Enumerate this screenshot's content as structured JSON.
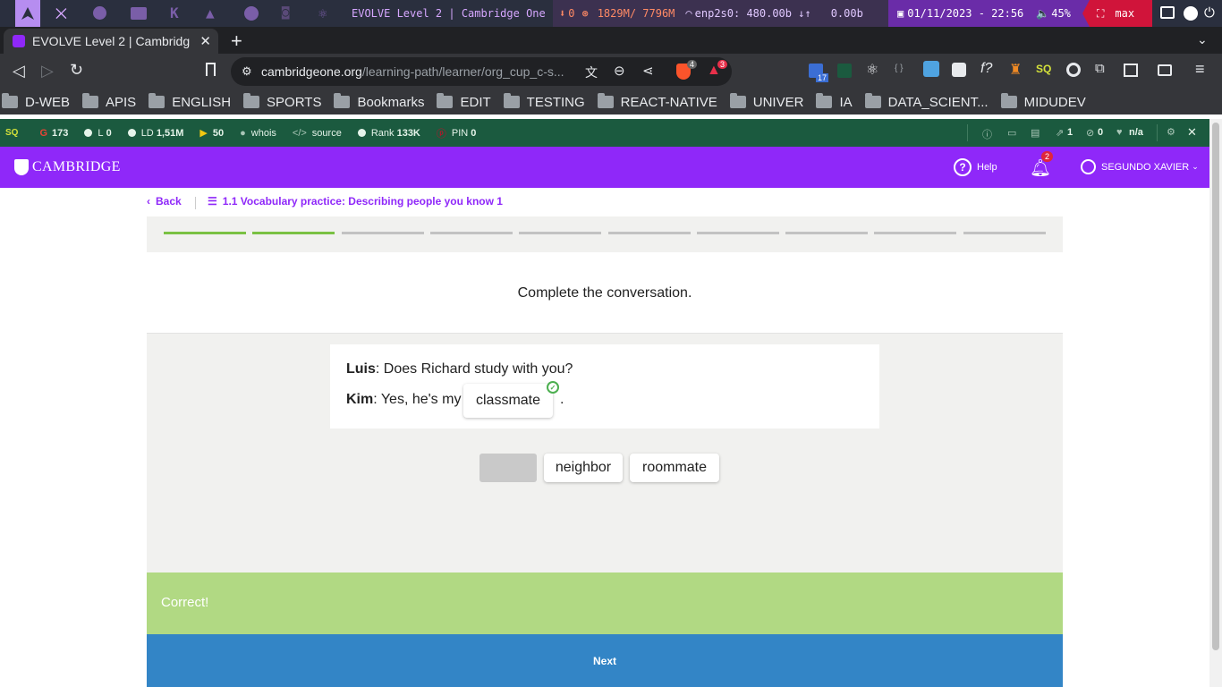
{
  "system_bar": {
    "window_title": "EVOLVE Level 2 | Cambridge One",
    "download": "0",
    "memory": "1829M/ 7796M",
    "network": "enp2s0: 480.00b ↓↑",
    "network_up": "0.00b",
    "datetime": "01/11/2023 - 22:56",
    "volume": "45%",
    "mode": "max"
  },
  "browser": {
    "tab_title": "EVOLVE Level 2 | Cambridg",
    "url_host": "cambridgeone.org",
    "url_path": "/learning-path/learner/org_cup_c-s...",
    "brave_badge": "4",
    "alert_badge": "3",
    "ext_badge": "17",
    "bookmarks": [
      "D-WEB",
      "APIS",
      "ENGLISH",
      "SPORTS",
      "Bookmarks",
      "EDIT",
      "TESTING",
      "REACT-NATIVE",
      "UNIVER",
      "IA",
      "DATA_SCIENT...",
      "MIDUDEV"
    ]
  },
  "seo_bar": {
    "g": "173",
    "l": "0",
    "ld_label": "LD",
    "ld": "1,51M",
    "b": "50",
    "whois": "whois",
    "source": "source",
    "rank_label": "Rank",
    "rank": "133K",
    "pin_label": "PIN",
    "pin": "0",
    "right_1": "1",
    "right_2": "0",
    "right_3": "n/a"
  },
  "site": {
    "logo": "CAMBRIDGE",
    "help": "Help",
    "notif_count": "2",
    "user": "SEGUNDO XAVIER"
  },
  "lesson": {
    "back": "Back",
    "title": "1.1 Vocabulary practice: Describing people you know 1",
    "progress_done": 2,
    "progress_total": 10,
    "instruction": "Complete the conversation.",
    "line1_speaker": "Luis",
    "line1_text": ": Does Richard study with you?",
    "line2_speaker": "Kim",
    "line2_text": ": Yes, he's my",
    "answer": "classmate",
    "line2_end": ".",
    "options": [
      "neighbor",
      "roommate"
    ],
    "feedback": "Correct!",
    "next": "Next"
  },
  "colors": {
    "header": "#8f28f9",
    "progress_done": "#7ac143",
    "feedback_bg": "#b1d983",
    "next_bg": "#3385c6",
    "seo_bar": "#1b5a3f"
  }
}
